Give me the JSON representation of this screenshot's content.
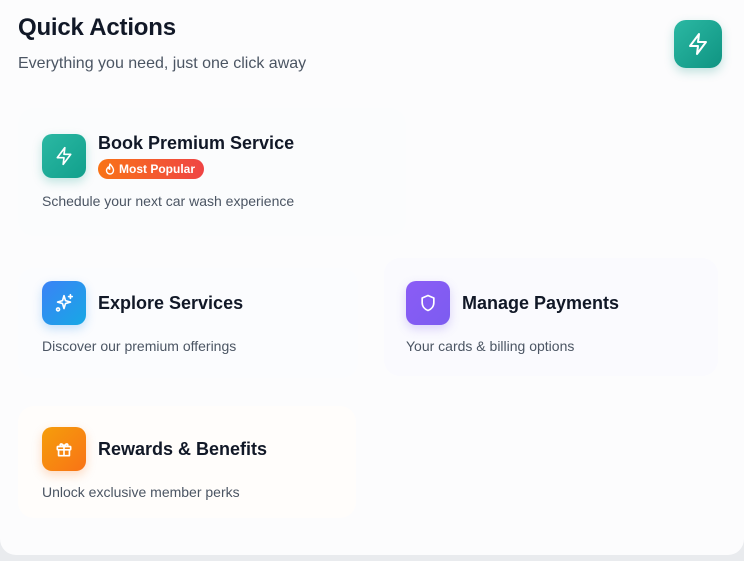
{
  "header": {
    "title": "Quick Actions",
    "subtitle": "Everything you need, just one click away",
    "icon": "lightning-icon"
  },
  "actions": [
    {
      "title": "Book Premium Service",
      "description": "Schedule your next car wash experience",
      "icon": "lightning-icon",
      "badge": "Most Popular",
      "badge_icon": "flame-icon",
      "color": "#14a896"
    },
    {
      "title": "Explore Services",
      "description": "Discover our premium offerings",
      "icon": "sparkles-icon",
      "color": "#2f8df0"
    },
    {
      "title": "Manage Payments",
      "description": "Your cards & billing options",
      "icon": "shield-icon",
      "color": "#8b5cf6"
    },
    {
      "title": "Rewards & Benefits",
      "description": "Unlock exclusive member perks",
      "icon": "gift-icon",
      "color": "#f7890f"
    }
  ]
}
